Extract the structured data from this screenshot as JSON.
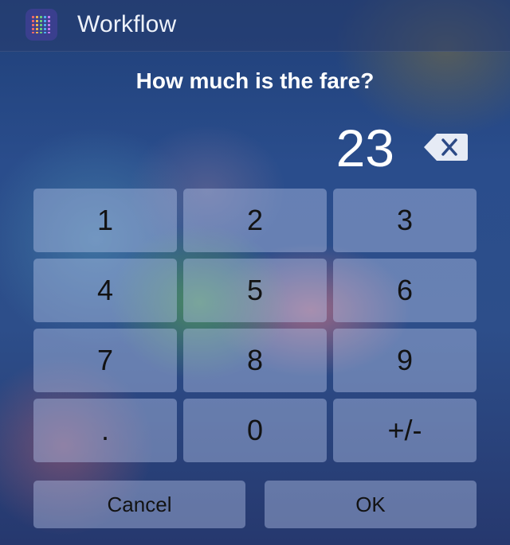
{
  "app": {
    "name": "Workflow",
    "icon": "workflow-app-icon"
  },
  "prompt": "How much is the fare?",
  "input": {
    "value": "23",
    "delete_icon": "backspace-icon"
  },
  "keypad": {
    "keys": [
      "1",
      "2",
      "3",
      "4",
      "5",
      "6",
      "7",
      "8",
      "9",
      ".",
      "0",
      "+/-"
    ]
  },
  "buttons": {
    "cancel": "Cancel",
    "ok": "OK"
  }
}
